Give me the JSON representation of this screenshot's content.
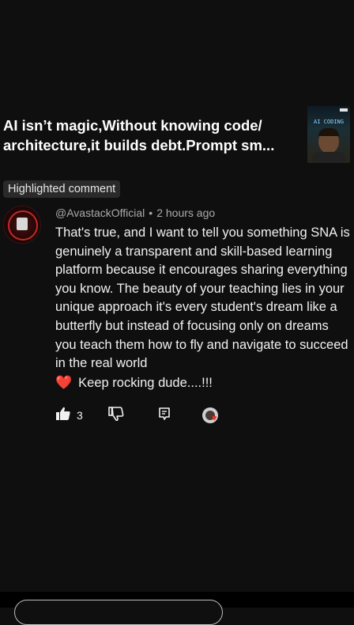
{
  "video": {
    "title": "AI isn’t magic,Without knowing code/ architecture,it builds debt.Prompt sm...",
    "thumbnail_text": "AI CODING"
  },
  "highlight": {
    "label": "Highlighted comment"
  },
  "comment": {
    "author": "@AvastackOfficial",
    "separator": "•",
    "time": "2 hours ago",
    "text": "That's true, and I want to tell you something SNA is genuinely a transparent and skill-based learning platform because it encourages sharing everything you know. The beauty of your teaching lies in your unique approach it's every student's dream  like a butterfly  but instead of focusing only on dreams you teach them how to fly and  navigate to succeed in the real world",
    "closing_emoji": "❤️",
    "closing_text": "Keep rocking dude....!!!",
    "likes": "3",
    "icons": {
      "like": "thumbs-up-icon",
      "dislike": "thumbs-down-icon",
      "reply": "reply-icon",
      "creator_heart": "creator-heart-icon"
    }
  },
  "colors": {
    "background": "#0f0f0f",
    "text": "#f1f1f1",
    "meta": "#aaaaaa",
    "chip": "#2a2a2a",
    "heart": "#ff2b2b"
  }
}
